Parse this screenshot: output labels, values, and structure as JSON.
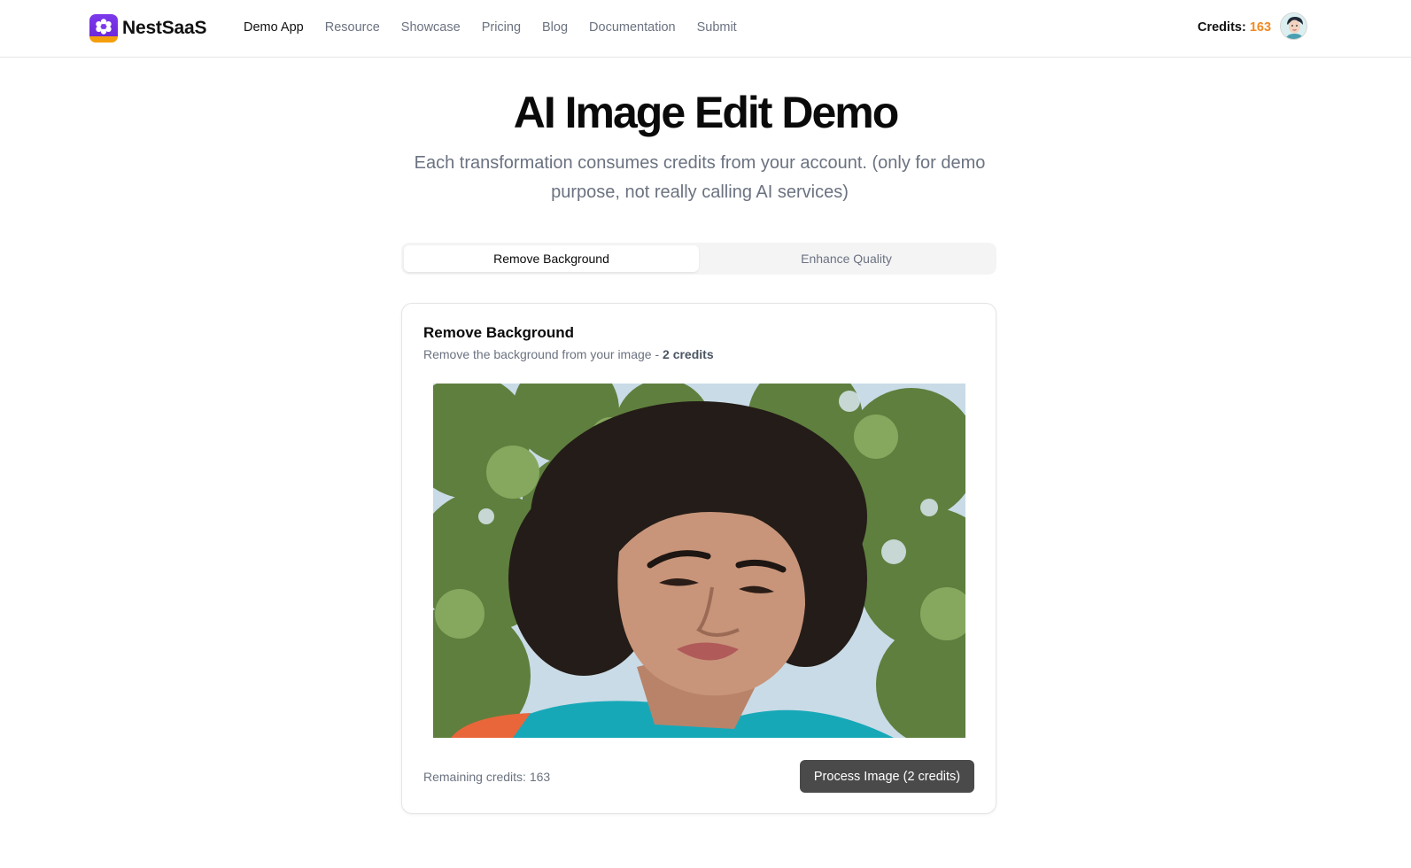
{
  "brand": {
    "name": "NestSaaS",
    "logo_icon": "flower-logo-icon",
    "colors": {
      "primary": "#6d28d9",
      "accent": "#f59e0b"
    }
  },
  "nav": {
    "items": [
      {
        "label": "Demo App",
        "active": true
      },
      {
        "label": "Resource",
        "active": false
      },
      {
        "label": "Showcase",
        "active": false
      },
      {
        "label": "Pricing",
        "active": false
      },
      {
        "label": "Blog",
        "active": false
      },
      {
        "label": "Documentation",
        "active": false
      },
      {
        "label": "Submit",
        "active": false
      }
    ]
  },
  "account": {
    "credits_label": "Credits:",
    "credits_value": "163",
    "credits_color": "#f08a24",
    "avatar_icon": "user-avatar"
  },
  "hero": {
    "title": "AI Image Edit Demo",
    "subtitle": "Each transformation consumes credits from your account. (only for demo purpose, not really calling AI services)"
  },
  "tabs": [
    {
      "label": "Remove Background",
      "active": true
    },
    {
      "label": "Enhance Quality",
      "active": false
    }
  ],
  "card": {
    "title": "Remove Background",
    "desc_prefix": "Remove the background from your image -",
    "desc_credits": "2 credits",
    "image_icon": "portrait-photo",
    "remaining": "Remaining credits: 163",
    "process_button": "Process Image (2 credits)"
  }
}
